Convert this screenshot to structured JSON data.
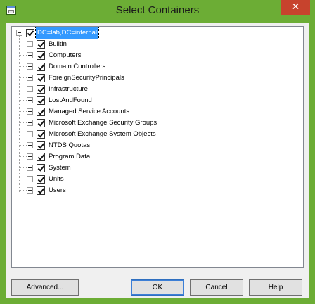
{
  "window": {
    "title": "Select Containers",
    "close_glyph": "✕"
  },
  "tree": {
    "root": {
      "label": "DC=lab,DC=internal",
      "checked": true,
      "expanded": true
    },
    "items": [
      {
        "label": "Builtin",
        "checked": true
      },
      {
        "label": "Computers",
        "checked": true
      },
      {
        "label": "Domain Controllers",
        "checked": true
      },
      {
        "label": "ForeignSecurityPrincipals",
        "checked": true
      },
      {
        "label": "Infrastructure",
        "checked": true
      },
      {
        "label": "LostAndFound",
        "checked": true
      },
      {
        "label": "Managed Service Accounts",
        "checked": true
      },
      {
        "label": "Microsoft Exchange Security Groups",
        "checked": true
      },
      {
        "label": "Microsoft Exchange System Objects",
        "checked": true
      },
      {
        "label": "NTDS Quotas",
        "checked": true
      },
      {
        "label": "Program Data",
        "checked": true
      },
      {
        "label": "System",
        "checked": true
      },
      {
        "label": "Units",
        "checked": true
      },
      {
        "label": "Users",
        "checked": true
      }
    ]
  },
  "buttons": {
    "advanced": "Advanced...",
    "ok": "OK",
    "cancel": "Cancel",
    "help": "Help"
  }
}
